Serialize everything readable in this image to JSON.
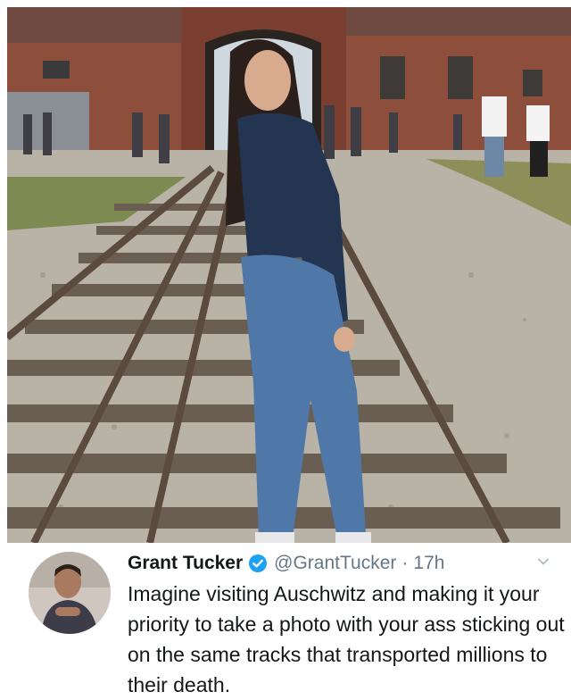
{
  "photo": {
    "alt_subject": "photo-attachment"
  },
  "tweet": {
    "author_name": "Grant Tucker",
    "verified_icon": "verified-badge-icon",
    "handle": "@GrantTucker",
    "separator": "·",
    "time": "17h",
    "menu_icon": "chevron-down-icon",
    "text": "Imagine visiting Auschwitz and making it your priority to take a photo with your ass sticking out on the same tracks that transported millions to their death."
  },
  "colors": {
    "verified_blue": "#1da1f2",
    "name_text": "#14171a",
    "meta_text": "#657786"
  }
}
